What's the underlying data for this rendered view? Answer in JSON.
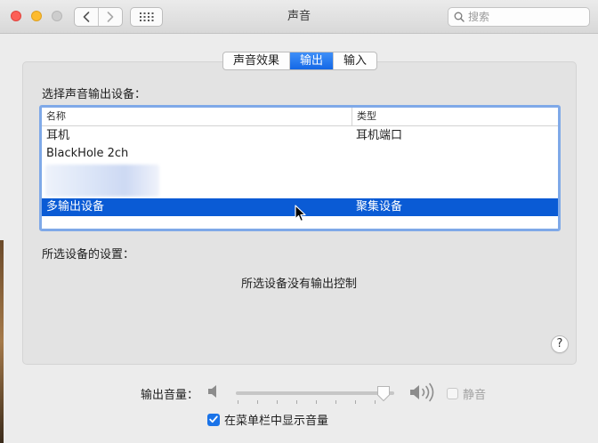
{
  "window": {
    "title": "声音"
  },
  "search": {
    "placeholder": "搜索"
  },
  "tabs": [
    {
      "label": "声音效果",
      "active": false
    },
    {
      "label": "输出",
      "active": true
    },
    {
      "label": "输入",
      "active": false
    }
  ],
  "output": {
    "select_label": "选择声音输出设备：",
    "columns": {
      "name": "名称",
      "type": "类型"
    },
    "devices": [
      {
        "name": "耳机",
        "type": "耳机端口",
        "selected": false
      },
      {
        "name": "BlackHole 2ch",
        "type": "",
        "selected": false
      },
      {
        "name": "",
        "type": "",
        "selected": false,
        "obscured": true
      },
      {
        "name": "多输出设备",
        "type": "聚集设备",
        "selected": true
      }
    ],
    "settings_label": "所选设备的设置：",
    "no_control_text": "所选设备没有输出控制"
  },
  "volume": {
    "label": "输出音量：",
    "level": 0.93,
    "mute_label": "静音",
    "muted": false,
    "show_in_menubar_label": "在菜单栏中显示音量",
    "show_in_menubar": true
  },
  "colors": {
    "accent": "#1a73e8",
    "selection": "#0a5bd5",
    "close": "#fc5f57",
    "minimize": "#fdbb2e"
  },
  "icons": {
    "back": "chevron-left-icon",
    "forward": "chevron-right-icon",
    "grid": "grid-icon",
    "search": "search-icon",
    "help": "help-icon",
    "volume_low": "speaker-low-icon",
    "volume_high": "speaker-high-icon"
  }
}
